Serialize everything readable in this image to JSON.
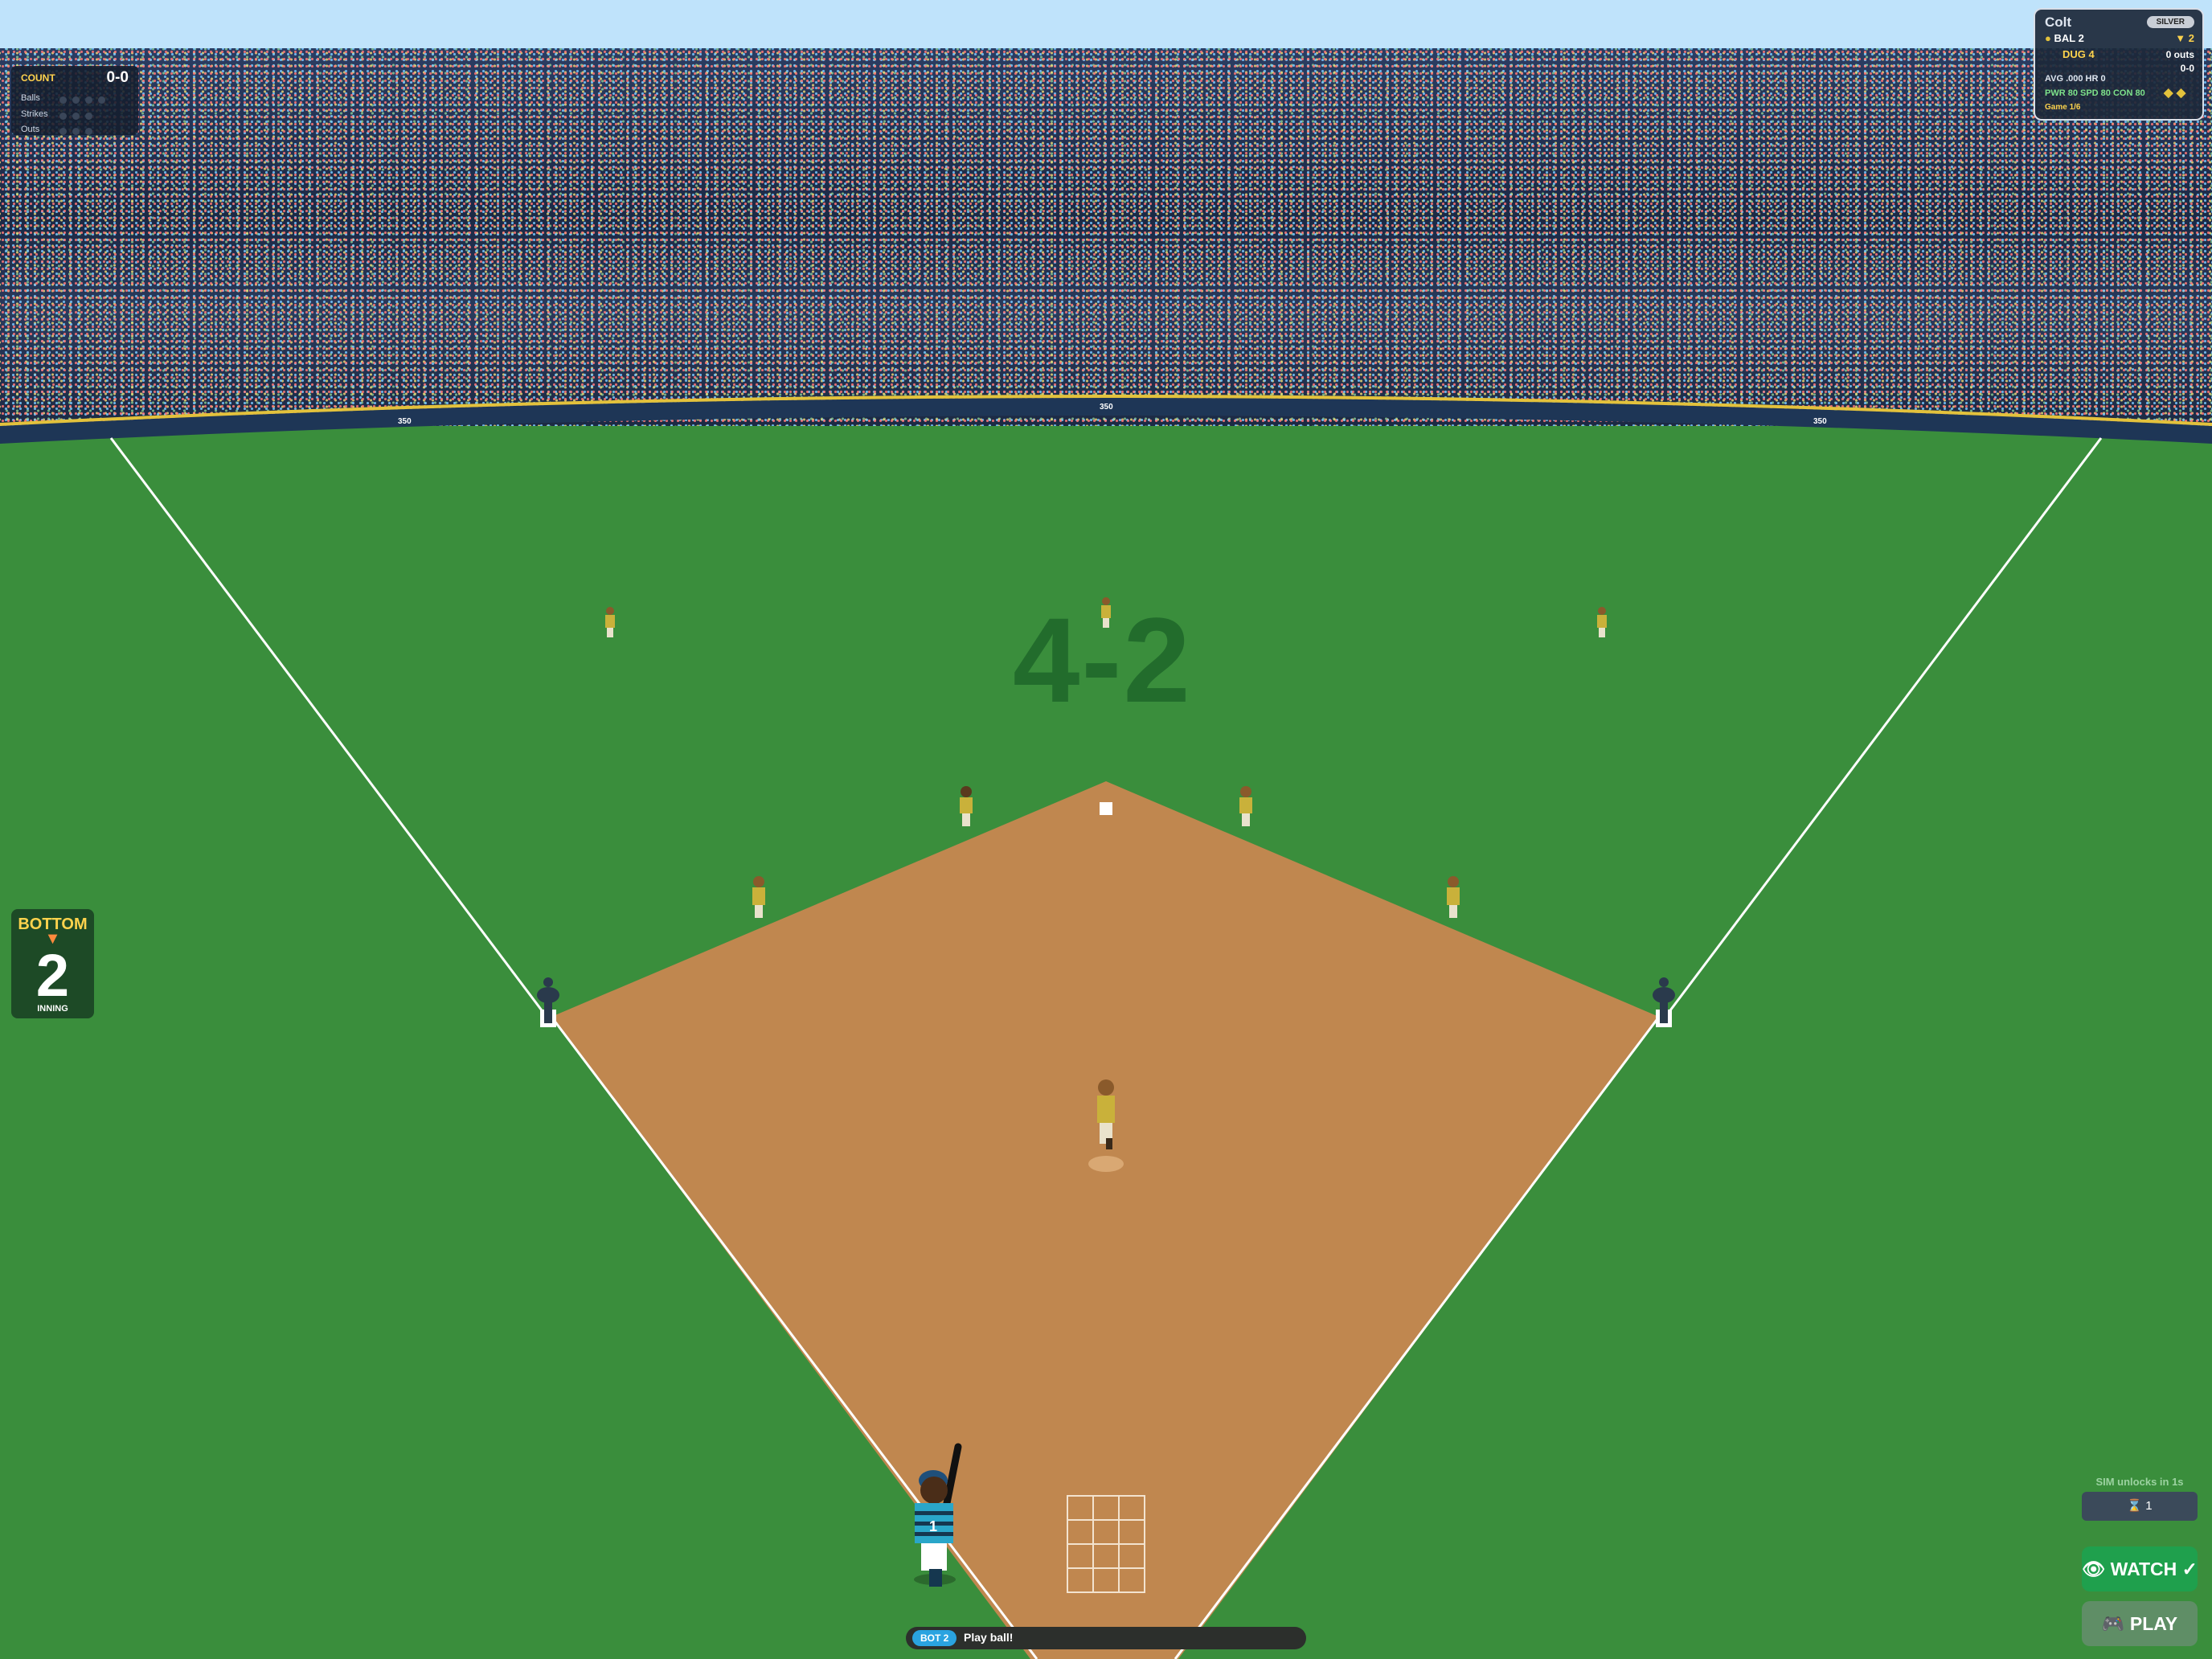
{
  "wall": {
    "left_distance": "350",
    "center_distance": "350",
    "right_distance": "350"
  },
  "count_panel": {
    "header": "COUNT",
    "value": "0-0",
    "balls_label": "Balls",
    "strikes_label": "Strikes",
    "outs_label": "Outs"
  },
  "player_card": {
    "name": "Colt",
    "tier": "SILVER",
    "away_team": "BAL 2",
    "home_team": "DUG 4",
    "inning_indicator": "▼ 2",
    "outs": "0 outs",
    "count": "0-0",
    "stats_line": "AVG .000   HR 0",
    "ratings_line": "PWR 80  SPD 80  CON 80",
    "game_progress": "Game 1/6"
  },
  "inning": {
    "half": "BOTTOM",
    "number": "2",
    "label": "INNING"
  },
  "field_score": "4-2",
  "batter": {
    "number": "1"
  },
  "sim": {
    "unlock_text": "SIM unlocks in 1s",
    "ticket_count": "1"
  },
  "buttons": {
    "watch_label": "WATCH ✓",
    "play_label": "PLAY"
  },
  "status_bar": {
    "badge": "BOT 2",
    "message": "Play ball!"
  },
  "colors": {
    "grass": "#3a8e3c",
    "dirt": "#c0874f",
    "home_team": "#1e8fb0",
    "away_team": "#c9b13a",
    "accent": "#ffd34d"
  }
}
